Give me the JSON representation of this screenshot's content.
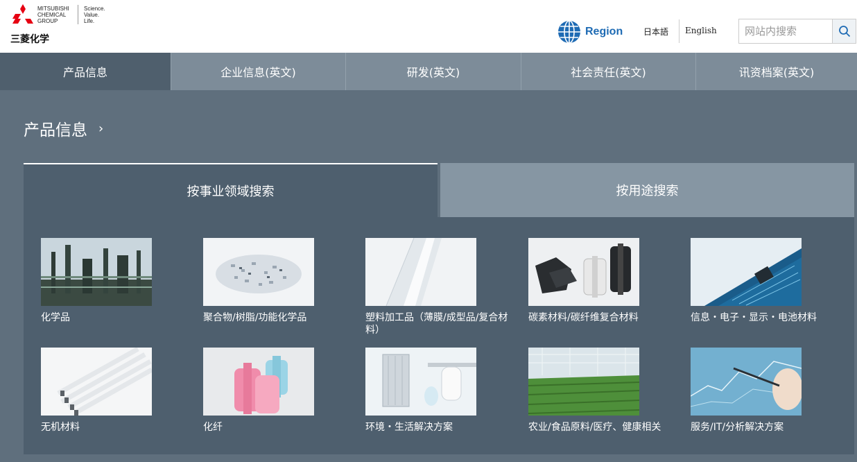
{
  "header": {
    "logo_company": [
      "MITSUBISHI",
      "CHEMICAL",
      "GROUP"
    ],
    "logo_tagline": [
      "Science.",
      "Value.",
      "Life."
    ],
    "logo_cn": "三菱化学",
    "region_label": "Region",
    "lang_jp": "日本語",
    "lang_en": "English",
    "search_placeholder": "网站内搜索"
  },
  "nav": {
    "items": [
      {
        "label": "产品信息",
        "active": true
      },
      {
        "label": "企业信息(英文)",
        "active": false
      },
      {
        "label": "研发(英文)",
        "active": false
      },
      {
        "label": "社会责任(英文)",
        "active": false
      },
      {
        "label": "讯资档案(英文)",
        "active": false
      }
    ]
  },
  "section": {
    "title": "产品信息",
    "chevron": "›"
  },
  "tabs": {
    "active": "按事业领域搜索",
    "inactive": "按用途搜索"
  },
  "products": [
    {
      "label": "化学品",
      "icon": "chemical-plant-image"
    },
    {
      "label": "聚合物/树脂/功能化学品",
      "icon": "resin-pellets-image"
    },
    {
      "label": "塑料加工品（薄膜/成型品/复合材料）",
      "icon": "plastic-film-image"
    },
    {
      "label": "碳素材料/碳纤维复合材料",
      "icon": "carbon-fiber-image"
    },
    {
      "label": "信息・电子・显示・电池材料",
      "icon": "circuit-board-image"
    },
    {
      "label": "无机材料",
      "icon": "fluorescent-tubes-image"
    },
    {
      "label": "化纤",
      "icon": "thread-spools-image"
    },
    {
      "label": "环境・生活解决方案",
      "icon": "water-purifier-image"
    },
    {
      "label": "农业/食品原料/医疗、健康相关",
      "icon": "greenhouse-image"
    },
    {
      "label": "服务/IT/分析解决方案",
      "icon": "analysis-chart-image"
    }
  ],
  "colors": {
    "page_bg": "#5f6f7d",
    "nav_bg": "#7d8c99",
    "nav_active": "#4f5f6d",
    "panel_bg": "#4e5f6e",
    "tab_inactive": "#8696a3",
    "brand_red": "#e60012",
    "region_blue": "#1e6bb4"
  }
}
